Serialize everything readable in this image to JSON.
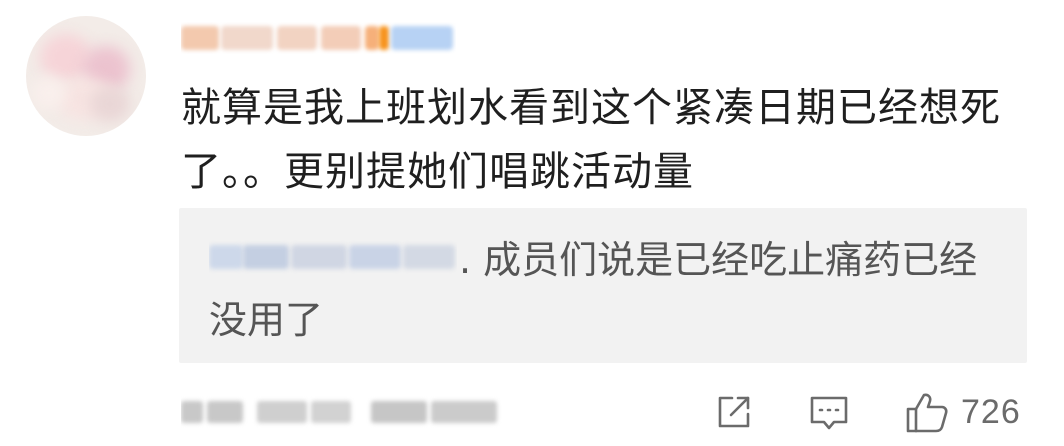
{
  "comment": {
    "line1": "就算是我上班划水看到这个紧凑日期已经想死",
    "line2": "了。。更别提她们唱跳活动量"
  },
  "reply": {
    "text": ". 成员们说是已经吃止痛药已经没用了"
  },
  "actions": {
    "share_icon": "share-icon",
    "reply_icon": "comment-icon",
    "like_icon": "thumbs-up-icon",
    "like_count": "726"
  },
  "colors": {
    "text": "#1f1f1f",
    "reply_bg": "#f2f2f2",
    "reply_text": "#555555",
    "icon_gray": "#6b6b6b"
  }
}
